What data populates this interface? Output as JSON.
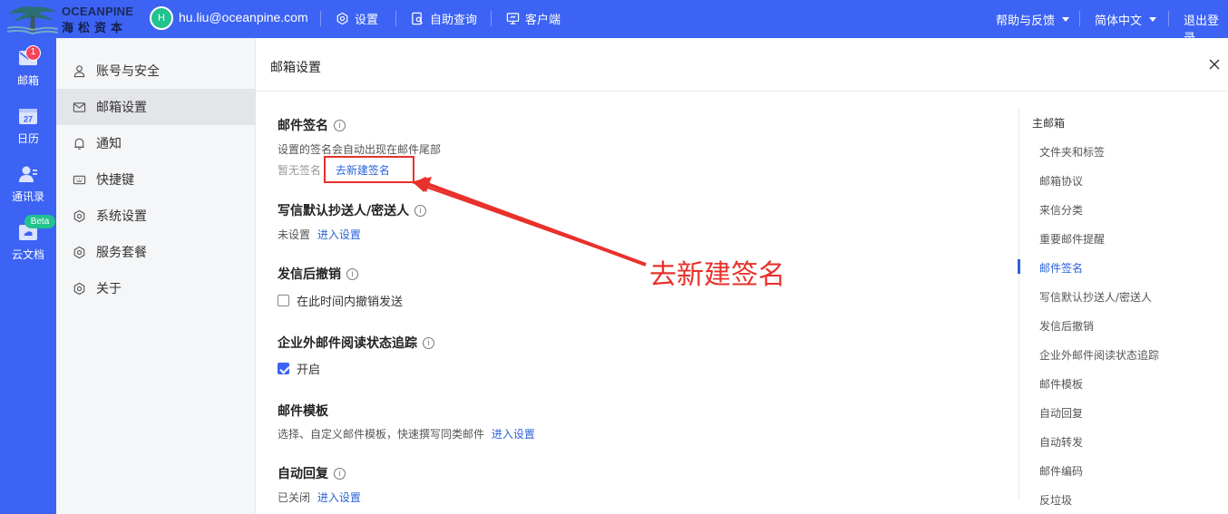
{
  "header": {
    "logo_en": "OCEANPINE",
    "logo_cn": "海松资本",
    "avatar_initial": "H",
    "email": "hu.liu@oceanpine.com",
    "settings": "设置",
    "self_query": "自助查询",
    "client": "客户端",
    "help": "帮助与反馈",
    "language": "简体中文",
    "logout": "退出登录"
  },
  "rail": {
    "mail": "邮箱",
    "mail_badge": "1",
    "calendar": "日历",
    "calendar_day": "27",
    "contacts": "通讯录",
    "docs": "云文档",
    "docs_badge": "Beta"
  },
  "menu": {
    "items": [
      {
        "label": "账号与安全",
        "icon": "user-icon"
      },
      {
        "label": "邮箱设置",
        "icon": "mail-icon"
      },
      {
        "label": "通知",
        "icon": "bell-icon"
      },
      {
        "label": "快捷键",
        "icon": "keyboard-icon"
      },
      {
        "label": "系统设置",
        "icon": "gear-icon"
      },
      {
        "label": "服务套餐",
        "icon": "gear-icon"
      },
      {
        "label": "关于",
        "icon": "gear-icon"
      }
    ]
  },
  "panel": {
    "title": "邮箱设置",
    "signature": {
      "title": "邮件签名",
      "desc": "设置的签名会自动出现在邮件尾部",
      "empty": "暂无签名",
      "link": "去新建签名"
    },
    "cc": {
      "title": "写信默认抄送人/密送人",
      "status": "未设置",
      "link": "进入设置"
    },
    "recall": {
      "title": "发信后撤销",
      "checkbox": "在此时间内撤销发送"
    },
    "tracking": {
      "title": "企业外邮件阅读状态追踪",
      "checkbox": "开启"
    },
    "template": {
      "title": "邮件模板",
      "desc": "选择、自定义邮件模板，快速撰写同类邮件",
      "link": "进入设置"
    },
    "autoreply": {
      "title": "自动回复",
      "status": "已关闭",
      "link": "进入设置"
    }
  },
  "annotation": "去新建签名",
  "anchors": {
    "head": "主邮箱",
    "items": [
      "文件夹和标签",
      "邮箱协议",
      "来信分类",
      "重要邮件提醒",
      "邮件签名",
      "写信默认抄送人/密送人",
      "发信后撤销",
      "企业外邮件阅读状态追踪",
      "邮件模板",
      "自动回复",
      "自动转发",
      "邮件编码",
      "反垃圾"
    ],
    "active_index": 4
  },
  "colors": {
    "brand": "#3c63f3",
    "link": "#2b63d9",
    "annotation": "#e8312b"
  }
}
